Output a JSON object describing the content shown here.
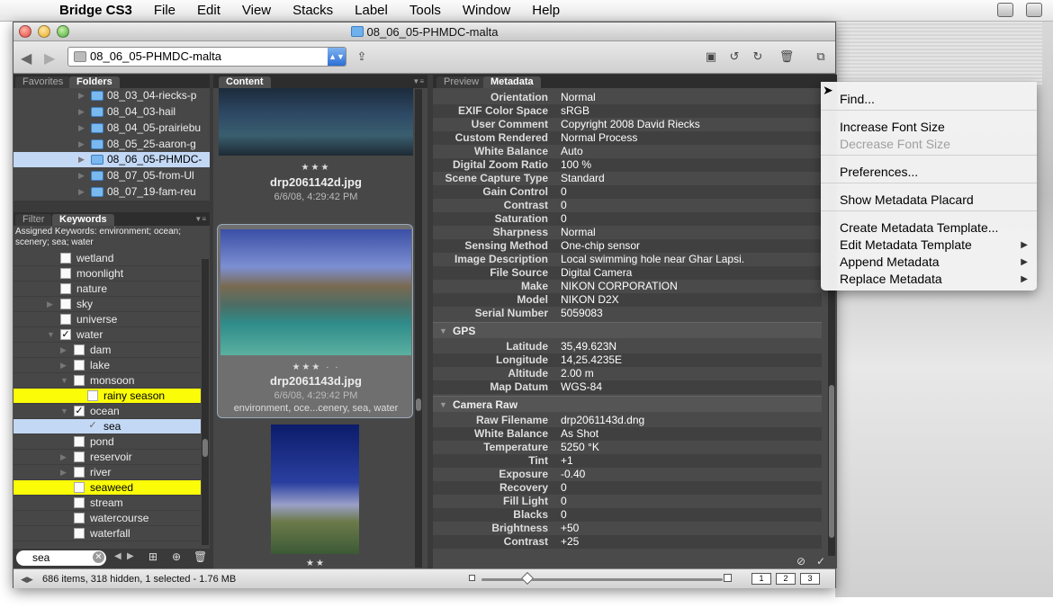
{
  "menubar": {
    "app": "Bridge CS3",
    "items": [
      "File",
      "Edit",
      "View",
      "Stacks",
      "Label",
      "Tools",
      "Window",
      "Help"
    ]
  },
  "window": {
    "title": "08_06_05-PHMDC-malta"
  },
  "toolbar": {
    "path": "08_06_05-PHMDC-malta"
  },
  "left_top_tabs": [
    "Favorites",
    "Folders"
  ],
  "folders": [
    "08_03_04-riecks-p",
    "08_04_03-hail",
    "08_04_05-prairiebu",
    "08_05_25-aaron-g",
    "08_06_05-PHMDC-",
    "08_07_05-from-Ul",
    "08_07_19-fam-reu"
  ],
  "left_bottom_tabs": [
    "Filter",
    "Keywords"
  ],
  "assigned_keywords": "Assigned Keywords: environment; ocean; scenery; sea; water",
  "keywords": [
    {
      "label": "wetland",
      "checked": false
    },
    {
      "label": "moonlight",
      "checked": false
    },
    {
      "label": "nature",
      "checked": false
    },
    {
      "label": "sky",
      "checked": false
    },
    {
      "label": "universe",
      "checked": false
    },
    {
      "label": "water",
      "checked": true
    },
    {
      "label": "dam",
      "checked": false
    },
    {
      "label": "lake",
      "checked": false
    },
    {
      "label": "monsoon",
      "checked": false
    },
    {
      "label": "rainy season",
      "checked": false
    },
    {
      "label": "ocean",
      "checked": true
    },
    {
      "label": "sea",
      "checked": true
    },
    {
      "label": "pond",
      "checked": false
    },
    {
      "label": "reservoir",
      "checked": false
    },
    {
      "label": "river",
      "checked": false
    },
    {
      "label": "seaweed",
      "checked": false
    },
    {
      "label": "stream",
      "checked": false
    },
    {
      "label": "watercourse",
      "checked": false
    },
    {
      "label": "waterfall",
      "checked": false
    }
  ],
  "search": {
    "value": "sea"
  },
  "content": {
    "tab": "Content",
    "items": [
      {
        "stars": "★★★",
        "name": "drp2061142d.jpg",
        "date": "6/6/08, 4:29:42 PM",
        "keywords": ""
      },
      {
        "stars": "★★★ · ·",
        "name": "drp2061143d.jpg",
        "date": "6/6/08, 4:29:42 PM",
        "keywords": "environment, oce...cenery, sea, water"
      },
      {
        "stars": "★★",
        "name": "",
        "date": "",
        "keywords": ""
      }
    ]
  },
  "meta_tabs": [
    "Preview",
    "Metadata"
  ],
  "metadata": {
    "camera_rows": [
      {
        "k": "Orientation",
        "v": "Normal"
      },
      {
        "k": "EXIF Color Space",
        "v": "sRGB"
      },
      {
        "k": "User Comment",
        "v": "Copyright 2008 David Rie­cks"
      },
      {
        "k": "Custom Rendered",
        "v": "Normal Process"
      },
      {
        "k": "White Balance",
        "v": "Auto"
      },
      {
        "k": "Digital Zoom Ratio",
        "v": "100 %"
      },
      {
        "k": "Scene Capture Type",
        "v": "Standard"
      },
      {
        "k": "Gain Control",
        "v": "0"
      },
      {
        "k": "Contrast",
        "v": "0"
      },
      {
        "k": "Saturation",
        "v": "0"
      },
      {
        "k": "Sharpness",
        "v": "Normal"
      },
      {
        "k": "Sensing Method",
        "v": "One-chip sensor"
      },
      {
        "k": "Image Description",
        "v": "Local swimming hole near Ghar Lapsi."
      },
      {
        "k": "File Source",
        "v": "Digital Camera"
      },
      {
        "k": "Make",
        "v": "NIKON CORPORATION"
      },
      {
        "k": "Model",
        "v": "NIKON D2X"
      },
      {
        "k": "Serial Number",
        "v": "5059083"
      }
    ],
    "gps_title": "GPS",
    "gps_rows": [
      {
        "k": "Latitude",
        "v": "35,49.623N"
      },
      {
        "k": "Longitude",
        "v": "14,25.4235E"
      },
      {
        "k": "Altitude",
        "v": "2.00 m"
      },
      {
        "k": "Map Datum",
        "v": "WGS-84"
      }
    ],
    "raw_title": "Camera Raw",
    "raw_rows": [
      {
        "k": "Raw Filename",
        "v": "drp2061143d.dng"
      },
      {
        "k": "White Balance",
        "v": "As Shot"
      },
      {
        "k": "Temperature",
        "v": "5250 °K"
      },
      {
        "k": "Tint",
        "v": "+1"
      },
      {
        "k": "Exposure",
        "v": "-0.40"
      },
      {
        "k": "Recovery",
        "v": "0"
      },
      {
        "k": "Fill Light",
        "v": "0"
      },
      {
        "k": "Blacks",
        "v": "0"
      },
      {
        "k": "Brightness",
        "v": "+50"
      },
      {
        "k": "Contrast",
        "v": "+25"
      }
    ]
  },
  "status": {
    "text": "686 items, 318 hidden, 1 selected - 1.76 MB",
    "view_buttons": [
      "1",
      "2",
      "3"
    ]
  },
  "context_menu": [
    {
      "label": "Find...",
      "disabled": false,
      "submenu": false
    },
    {
      "label": "Increase Font Size",
      "disabled": false,
      "submenu": false
    },
    {
      "label": "Decrease Font Size",
      "disabled": true,
      "submenu": false
    },
    {
      "label": "Preferences...",
      "disabled": false,
      "submenu": false
    },
    {
      "label": "Show Metadata Placard",
      "disabled": false,
      "submenu": false
    },
    {
      "label": "Create Metadata Template...",
      "disabled": false,
      "submenu": false
    },
    {
      "label": "Edit Metadata Template",
      "disabled": false,
      "submenu": true
    },
    {
      "label": "Append Metadata",
      "disabled": false,
      "submenu": true
    },
    {
      "label": "Replace Metadata",
      "disabled": false,
      "submenu": true
    }
  ],
  "colors": {
    "highlight": "#fbfc08",
    "selection": "#c3d8f5",
    "panel": "#474747"
  }
}
